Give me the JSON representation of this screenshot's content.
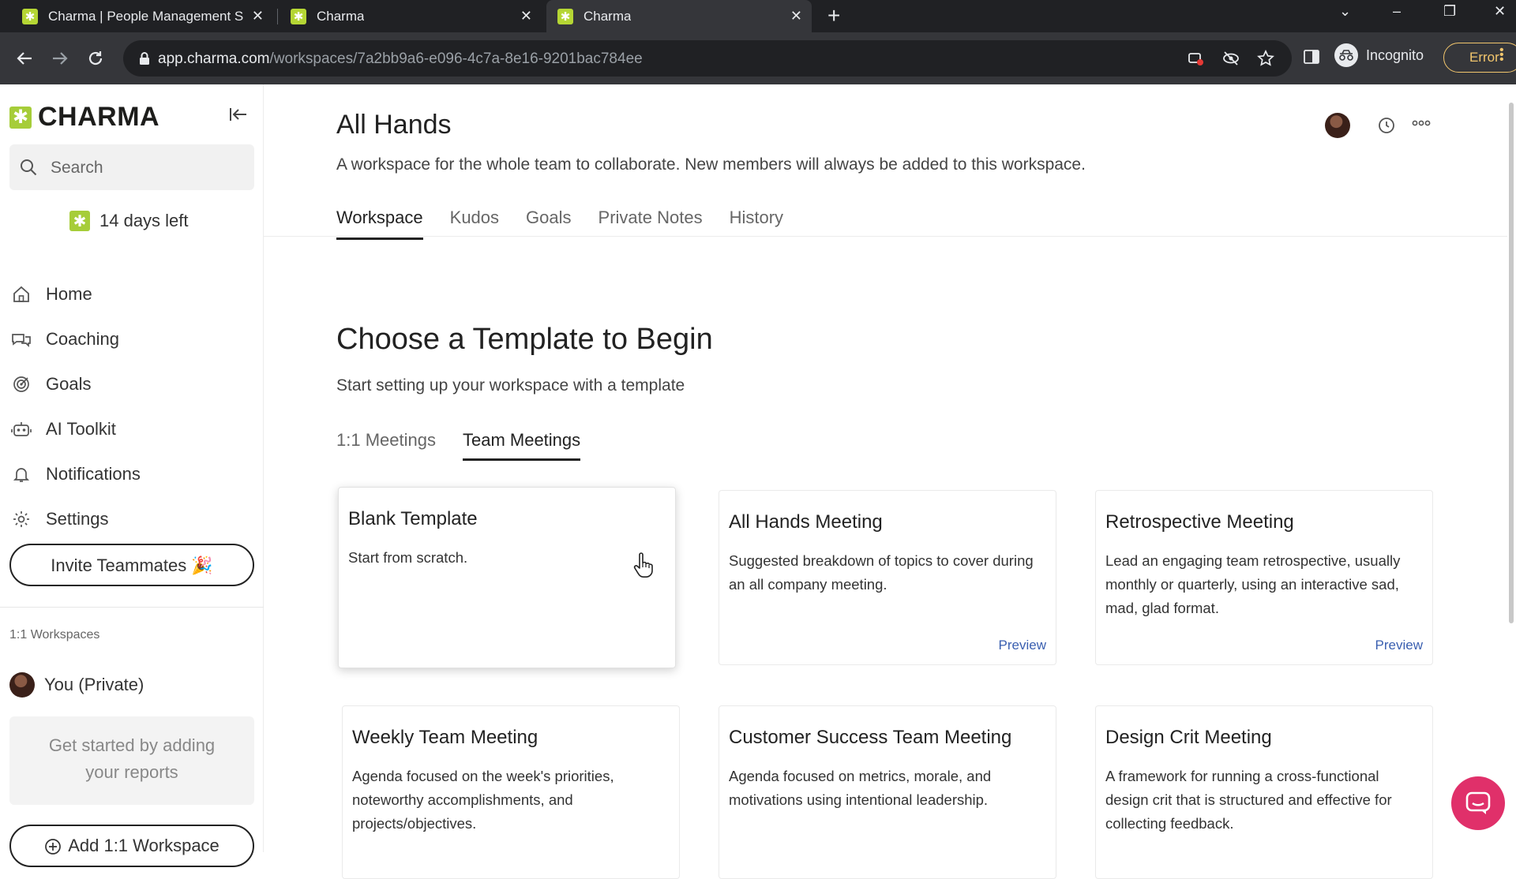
{
  "browser": {
    "tabs": [
      {
        "title": "Charma | People Management S",
        "active": false
      },
      {
        "title": "Charma",
        "active": false
      },
      {
        "title": "Charma",
        "active": true
      }
    ],
    "url_host": "app.charma.com",
    "url_path": "/workspaces/7a2bb9a6-e096-4c7a-8e16-9201bac784ee",
    "incognito_label": "Incognito",
    "error_label": "Error"
  },
  "sidebar": {
    "logo": "CHARMA",
    "search_placeholder": "Search",
    "trial": "14 days left",
    "nav": [
      {
        "label": "Home",
        "icon": "home-icon"
      },
      {
        "label": "Coaching",
        "icon": "coaching-icon"
      },
      {
        "label": "Goals",
        "icon": "target-icon"
      },
      {
        "label": "AI Toolkit",
        "icon": "robot-icon"
      },
      {
        "label": "Notifications",
        "icon": "bell-icon"
      },
      {
        "label": "Settings",
        "icon": "gear-icon"
      }
    ],
    "invite_label": "Invite Teammates 🎉",
    "workspaces_label": "1:1 Workspaces",
    "private_label": "You (Private)",
    "reports_hint": "Get started by adding your reports",
    "add_workspace_label": "Add 1:1 Workspace"
  },
  "main": {
    "title": "All Hands",
    "subtitle": "A workspace for the whole team to collaborate. New members will always be added to this workspace.",
    "tabs": [
      {
        "label": "Workspace",
        "active": true
      },
      {
        "label": "Kudos",
        "active": false
      },
      {
        "label": "Goals",
        "active": false
      },
      {
        "label": "Private Notes",
        "active": false
      },
      {
        "label": "History",
        "active": false
      }
    ],
    "template_title": "Choose a Template to Begin",
    "template_subtitle": "Start setting up your workspace with a template",
    "template_tabs": [
      {
        "label": "1:1 Meetings",
        "active": false
      },
      {
        "label": "Team Meetings",
        "active": true
      }
    ],
    "preview_label": "Preview",
    "cards": [
      {
        "title": "Blank Template",
        "desc": "Start from scratch."
      },
      {
        "title": "All Hands Meeting",
        "desc": "Suggested breakdown of topics to cover during an all company meeting."
      },
      {
        "title": "Retrospective Meeting",
        "desc": "Lead an engaging team retrospective, usually monthly or quarterly, using an interactive sad, mad, glad format."
      },
      {
        "title": "Weekly Team Meeting",
        "desc": "Agenda focused on the week's priorities, noteworthy accomplishments, and projects/objectives."
      },
      {
        "title": "Customer Success Team Meeting",
        "desc": "Agenda focused on metrics, morale, and motivations using intentional leadership."
      },
      {
        "title": "Design Crit Meeting",
        "desc": "A framework for running a cross-functional design crit that is structured and effective for collecting feedback."
      }
    ]
  },
  "colors": {
    "brand_green": "#a6cd39",
    "link_blue": "#3a5fb0",
    "chat_pink": "#e0306a",
    "error_amber": "#f2c66d"
  }
}
